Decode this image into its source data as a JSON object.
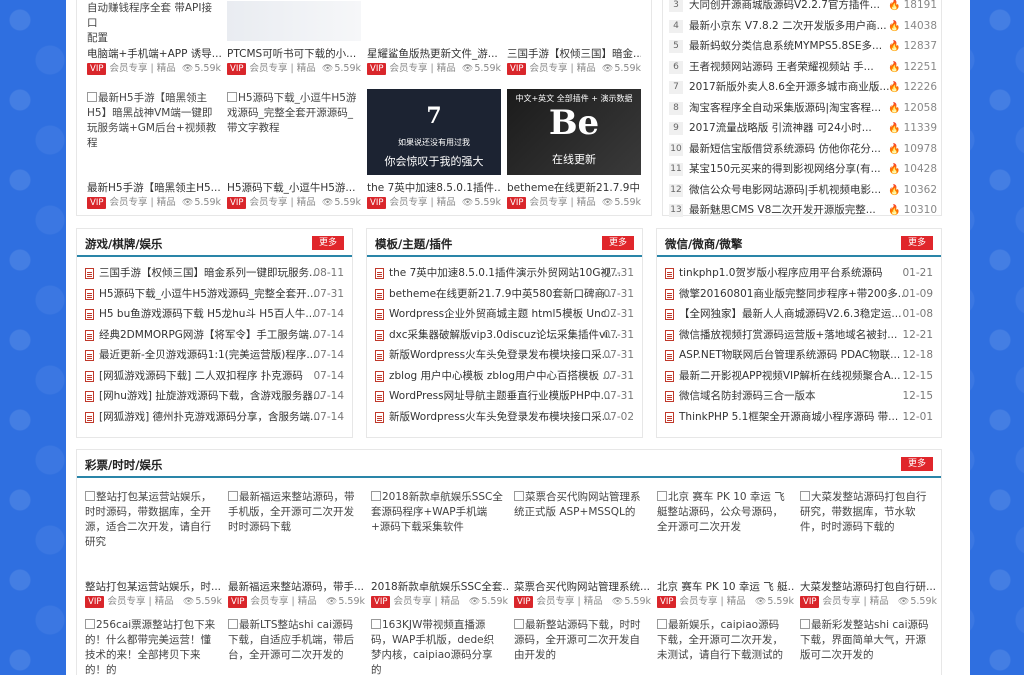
{
  "top_grid": {
    "row1": [
      {
        "alt": "",
        "title": "电脑端+手机端+APP 诱导...",
        "extra": [
          "自动赚钱程序全套 带API接口",
          "配置"
        ],
        "views": "5.59k"
      },
      {
        "alt": "",
        "title": "PTCMS可听书可下载的小...",
        "views": "5.59k"
      },
      {
        "alt": "",
        "title": "星耀鲨鱼版热更新文件_游...",
        "views": "5.59k"
      },
      {
        "alt": "",
        "title": "三国手游【权倾三国】暗金...",
        "views": "5.59k"
      }
    ],
    "row2": [
      {
        "alt": "最新H5手游【暗黑领主H5】暗黑战神VM端一键即玩服务端+GM后台+视频教程",
        "title": "最新H5手游【暗黑领主H5...",
        "views": "5.59k"
      },
      {
        "alt": "H5源码下载_小逗牛H5游戏源码_完整全套开源源码_带文字教程",
        "title": "H5源码下载_小逗牛H5游...",
        "views": "5.59k"
      },
      {
        "alt": "",
        "poster_text": [
          "如果说还没有用过我",
          "你会惊叹于我的强大"
        ],
        "poster_num": "7",
        "title": "the 7英中加速8.5.0.1插件...",
        "views": "5.59k"
      },
      {
        "alt": "",
        "poster_text": [
          "中文+英文 全部插件 + 演示数据",
          "在线更新"
        ],
        "poster_num": "Be",
        "title": "betheme在线更新21.7.9中...",
        "views": "5.59k"
      }
    ],
    "vip_label": "VIP",
    "member_label": "会员专享",
    "tag_label": "精品"
  },
  "rank": [
    {
      "num": "3",
      "title": "大同创开源商城版源码V2.2.7官方插件...",
      "heat": "18191"
    },
    {
      "num": "4",
      "title": "最新小京东 V7.8.2 二次开发版多用户商...",
      "heat": "14038"
    },
    {
      "num": "5",
      "title": "最新蚂蚁分类信息系统MYMPS5.8SE多...",
      "heat": "12837"
    },
    {
      "num": "6",
      "title": "王者视频网站源码 王者荣耀视频站 手...",
      "heat": "12251"
    },
    {
      "num": "7",
      "title": "2017新版外卖人8.6全开源多城市商业版...",
      "heat": "12226"
    },
    {
      "num": "8",
      "title": "淘宝客程序全自动采集版源码|淘宝客程...",
      "heat": "12058"
    },
    {
      "num": "9",
      "title": "2017流量战略版 引流神器 可24小时...",
      "heat": "11339"
    },
    {
      "num": "10",
      "title": "最新短信宝版借贷系统源码 仿他你花分...",
      "heat": "10978"
    },
    {
      "num": "11",
      "title": "某宝150元买来的得到影视网络分享(有...",
      "heat": "10428"
    },
    {
      "num": "12",
      "title": "微信公众号电影网站源码|手机视频电影...",
      "heat": "10362"
    },
    {
      "num": "13",
      "title": "最新魅思CMS V8二次开发开源版完整...",
      "heat": "10310"
    }
  ],
  "sections": [
    {
      "title": "游戏/棋牌/娱乐",
      "more": "更多",
      "items": [
        {
          "t": "三国手游【权倾三国】暗金系列一键即玩服务...",
          "d": "08-11"
        },
        {
          "t": "H5源码下载_小逗牛H5游戏源码_完整全套开...",
          "d": "07-31"
        },
        {
          "t": "H5 bu鱼游戏源码下载 H5龙hu斗 H5百人牛...",
          "d": "07-14"
        },
        {
          "t": "经典2DMMORPG网游【将军令】手工服务端...",
          "d": "07-14"
        },
        {
          "t": "最近更新-全贝游戏源码1:1(完美运营版)程序...",
          "d": "07-14"
        },
        {
          "t": "[网狐游戏源码下载] 二人双扣程序 扑克源码",
          "d": "07-14"
        },
        {
          "t": "[网hu游戏] 扯旋游戏源码下载，含游戏服务器...",
          "d": "07-14"
        },
        {
          "t": "[网狐游戏] 德州扑克游戏源码分享，含服务端...",
          "d": "07-14"
        }
      ]
    },
    {
      "title": "模板/主题/插件",
      "more": "更多",
      "items": [
        {
          "t": "the 7英中加速8.5.0.1插件演示外贸网站10G视...",
          "d": "07-31"
        },
        {
          "t": "betheme在线更新21.7.9中英580套新口碑商...",
          "d": "07-31"
        },
        {
          "t": "Wordpress企业外贸商城主题 html5模板 Unc...",
          "d": "07-31"
        },
        {
          "t": "dxc采集器破解版vip3.0discuz论坛采集插件vi...",
          "d": "07-31"
        },
        {
          "t": "新版Wordpress火车头免登录发布模块接口采...",
          "d": "07-31"
        },
        {
          "t": "zblog 用户中心模板 zblog用户中心百搭模板 ...",
          "d": "07-31"
        },
        {
          "t": "WordPress网址导航主题垂直行业模版PHP中...",
          "d": "07-31"
        },
        {
          "t": "新版Wordpress火车头免登录发布模块接口采...",
          "d": "07-02"
        }
      ]
    },
    {
      "title": "微信/微商/微擎",
      "more": "更多",
      "items": [
        {
          "t": "tinkphp1.0贺岁版小程序应用平台系统源码",
          "d": "01-21"
        },
        {
          "t": "微擎20160801商业版完整同步程序+带200多...",
          "d": "01-09"
        },
        {
          "t": "【全网独家】最新人人商城源码V2.6.3稳定运...",
          "d": "01-08"
        },
        {
          "t": "微信播放视频打赏源码运营版+落地域名被封...",
          "d": "12-21"
        },
        {
          "t": "ASP.NET物联网后台管理系统源码 PDAC物联...",
          "d": "12-18"
        },
        {
          "t": "最新二开影视APP视频VIP解析在线视频聚合A...",
          "d": "12-15"
        },
        {
          "t": "微信域名防封源码三合一版本",
          "d": "12-15"
        },
        {
          "t": "ThinkPHP 5.1框架全开源商城小程序源码 带...",
          "d": "12-01"
        }
      ]
    }
  ],
  "lottery": {
    "title": "彩票/时时/娱乐",
    "more": "更多",
    "row1": [
      {
        "alt": "整站打包某运营站娱乐，时时源码，带数据库，全开源，适合二次开发，请自行研究",
        "title": "整站打包某运营站娱乐，时...",
        "views": "5.59k"
      },
      {
        "alt": "最新福运来整站源码，带手机版，全开源可二次开发时时源码下载",
        "title": "最新福运来整站源码，带手...",
        "views": "5.59k"
      },
      {
        "alt": "2018新款卓航娱乐SSC全套源码程序+WAP手机端+源码下载采集软件",
        "title": "2018新款卓航娱乐SSC全套...",
        "views": "5.59k"
      },
      {
        "alt": "菜票合买代购网站管理系统正式版 ASP+MSSQL的",
        "title": "菜票合买代购网站管理系统...",
        "views": "5.59k"
      },
      {
        "alt": "北京 赛车 PK 10 幸运 飞艇整站源码，公众号源码，全开源可二次开发",
        "title": "北京 赛车 PK 10 幸运 飞 艇...",
        "views": "5.59k"
      },
      {
        "alt": "大菜发整站源码打包自行研究，带数据库，节水软件，时时源码下载的",
        "title": "大菜发整站源码打包自行研...",
        "views": "5.59k"
      }
    ],
    "row2": [
      {
        "alt": "256cai票源整站打包下来的！什么都带完美运营！懂技术的来！全部拷贝下来的！的"
      },
      {
        "alt": "最新LTS整站shi cai源码下载，自适应手机端，带后台，全开源可二次开发的"
      },
      {
        "alt": "163KJW带视频直播源码，WAP手机版，dede织梦内核，caipiao源码分享的"
      },
      {
        "alt": "最新整站源码下载，时时源码，全开源可二次开发自由开发的"
      },
      {
        "alt": "最新娱乐，caipiao源码下载，全开源可二次开发，未测试，请自行下载测试的"
      },
      {
        "alt": "最新彩发整站shi cai源码下载，界面简单大气，开源版可二次开发的"
      }
    ]
  }
}
